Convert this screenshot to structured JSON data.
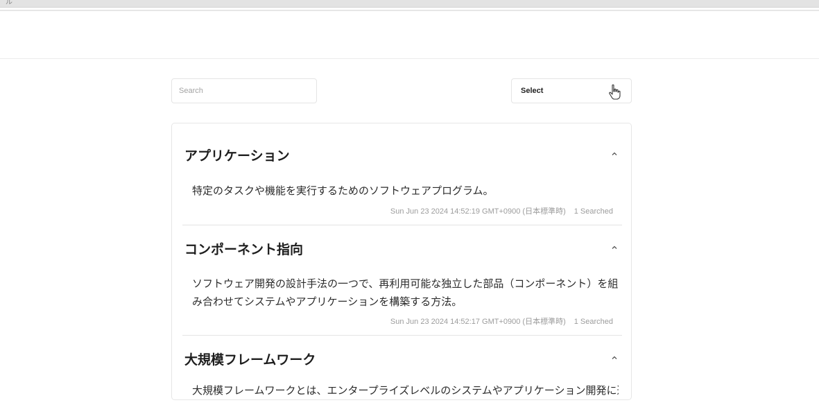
{
  "browser": {
    "tab_glyph": "ル"
  },
  "search": {
    "placeholder": "Search"
  },
  "select": {
    "value": "Select"
  },
  "items": [
    {
      "title": "アプリケーション",
      "description": "特定のタスクや機能を実行するためのソフトウェアプログラム。",
      "timestamp": "Sun Jun 23 2024 14:52:19 GMT+0900 (日本標準時)",
      "searched": "1 Searched"
    },
    {
      "title": "コンポーネント指向",
      "description": "ソフトウェア開発の設計手法の一つで、再利用可能な独立した部品（コンポーネント）を組み合わせてシステムやアプリケーションを構築する方法。",
      "timestamp": "Sun Jun 23 2024 14:52:17 GMT+0900 (日本標準時)",
      "searched": "1 Searched"
    },
    {
      "title": "大規模フレームワーク",
      "description": "大規模フレームワークとは、エンタープライズレベルのシステムやアプリケーション開発に適し",
      "timestamp": "",
      "searched": ""
    }
  ],
  "icons": {
    "chevron": "chevron-up-icon",
    "cursor": "hand-pointer-icon"
  }
}
